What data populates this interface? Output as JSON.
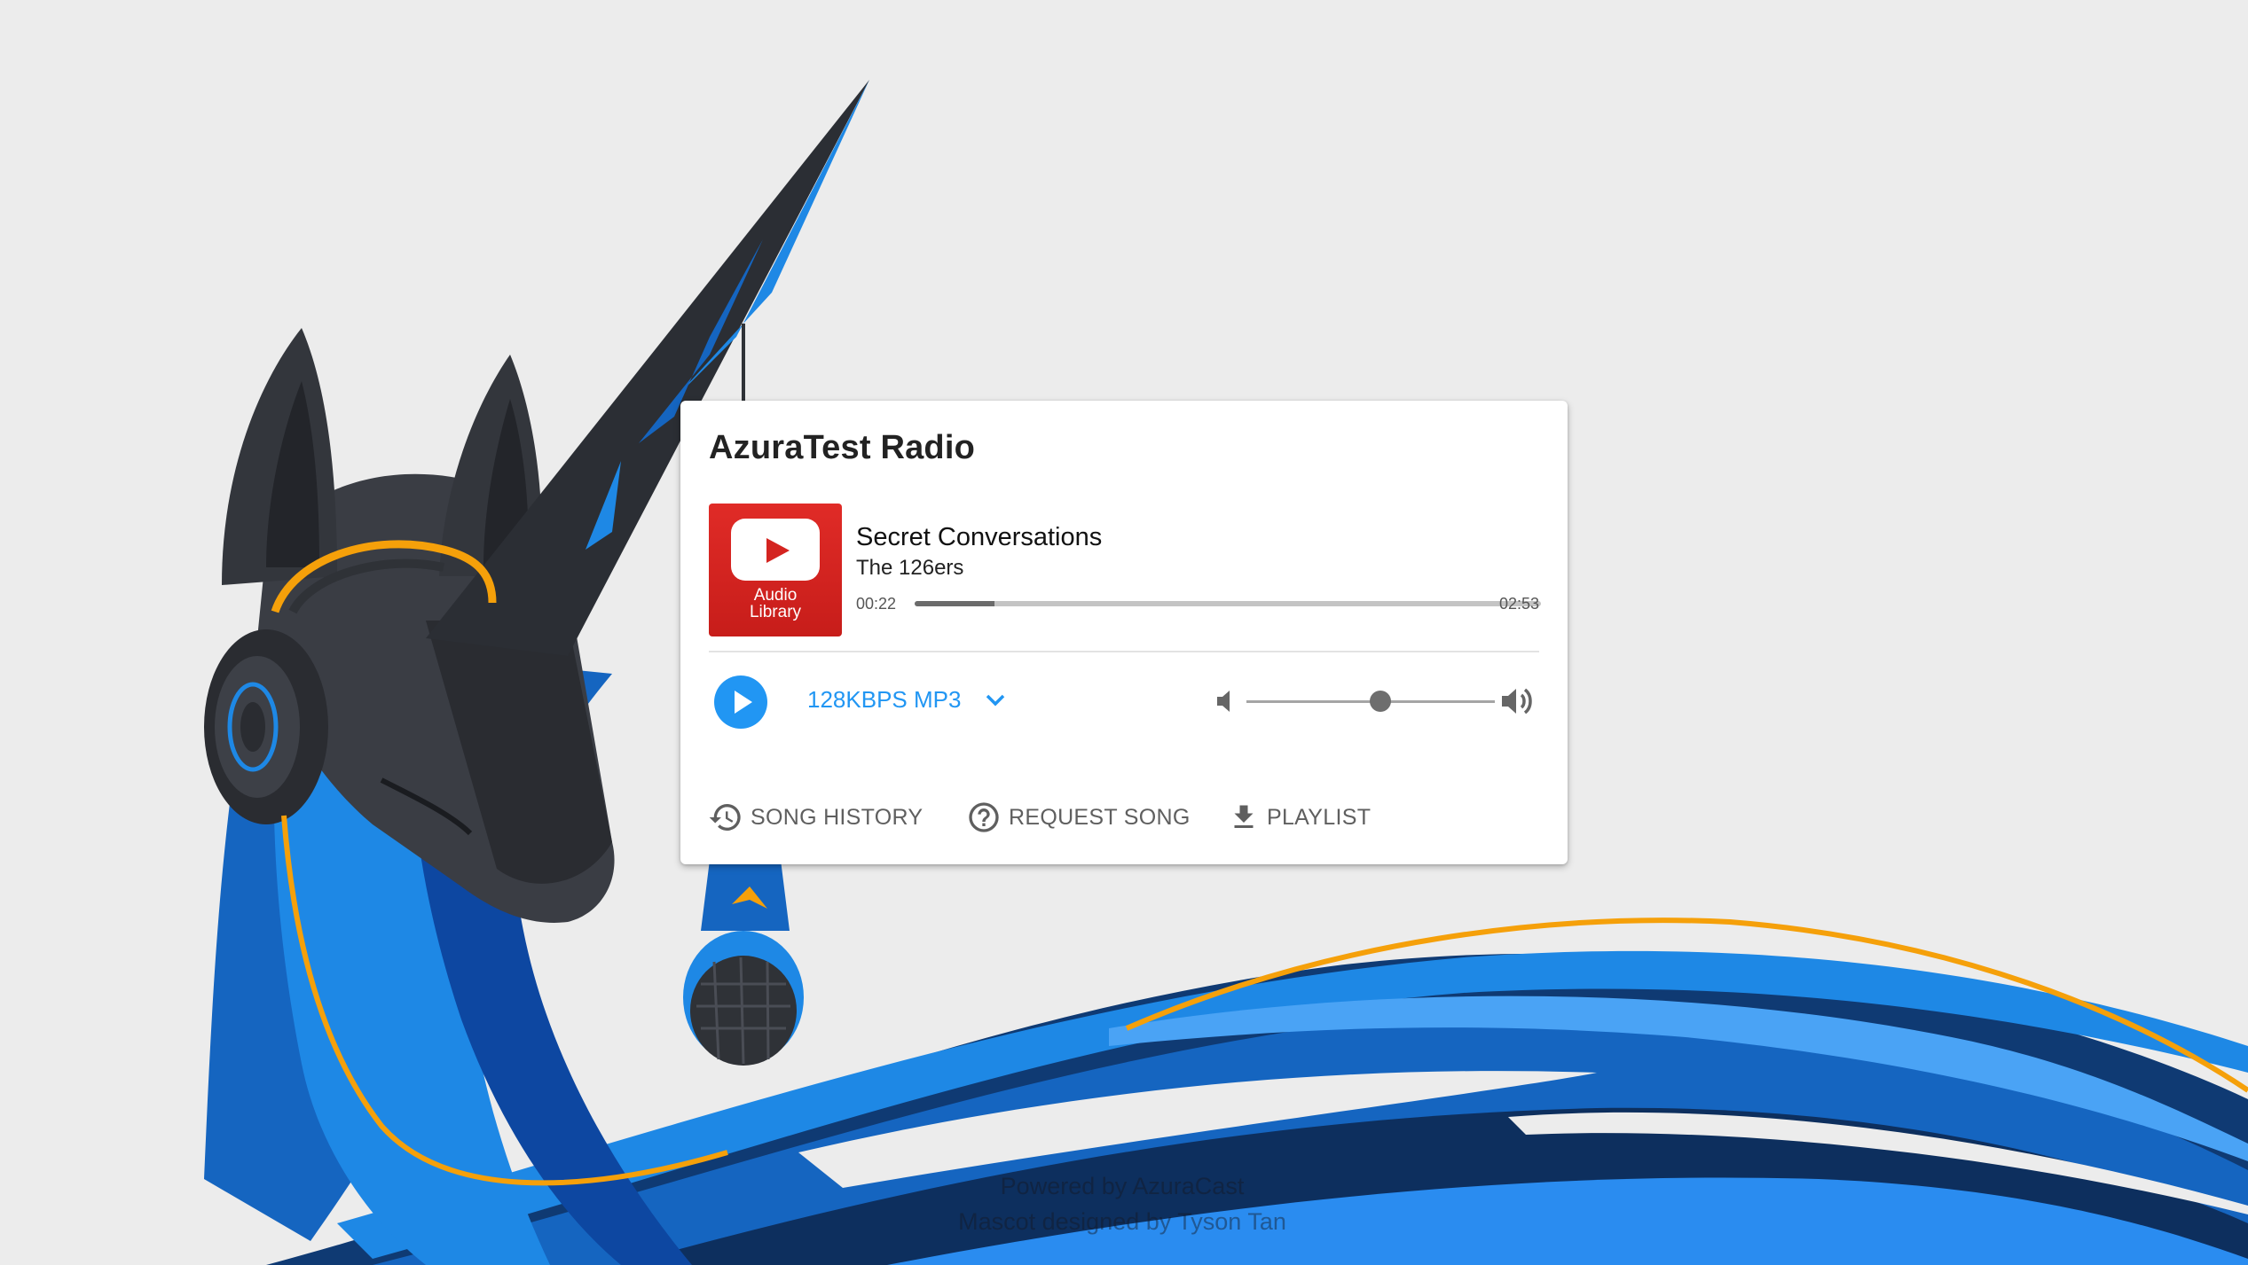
{
  "station": {
    "name": "AzuraTest Radio"
  },
  "now_playing": {
    "title": "Secret Conversations",
    "artist": "The 126ers",
    "album_art_label": "Audio Library",
    "elapsed": "00:22",
    "duration": "02:53",
    "progress_fraction": 0.127
  },
  "player": {
    "stream_label": "128KBPS MP3",
    "volume_fraction": 0.54
  },
  "tabs": {
    "history": "SONG HISTORY",
    "request": "REQUEST SONG",
    "playlist": "PLAYLIST"
  },
  "credits": {
    "powered_prefix": "Powered by ",
    "powered_link": "AzuraCast",
    "mascot_prefix": "Mascot designed by ",
    "mascot_link": "Tyson Tan"
  },
  "colors": {
    "background": "#ececec",
    "accent": "#2196f3",
    "album_red": "#d42420",
    "mascot_blue": "#1976d2",
    "mascot_dark": "#2f3237",
    "mascot_orange": "#f5a00a"
  },
  "icons": {
    "play": "play-icon",
    "dropdown": "chevron-down-icon",
    "volume_mute": "volume-mute-icon",
    "volume_max": "volume-up-icon",
    "history": "history-icon",
    "request": "help-circle-icon",
    "playlist": "download-icon"
  }
}
